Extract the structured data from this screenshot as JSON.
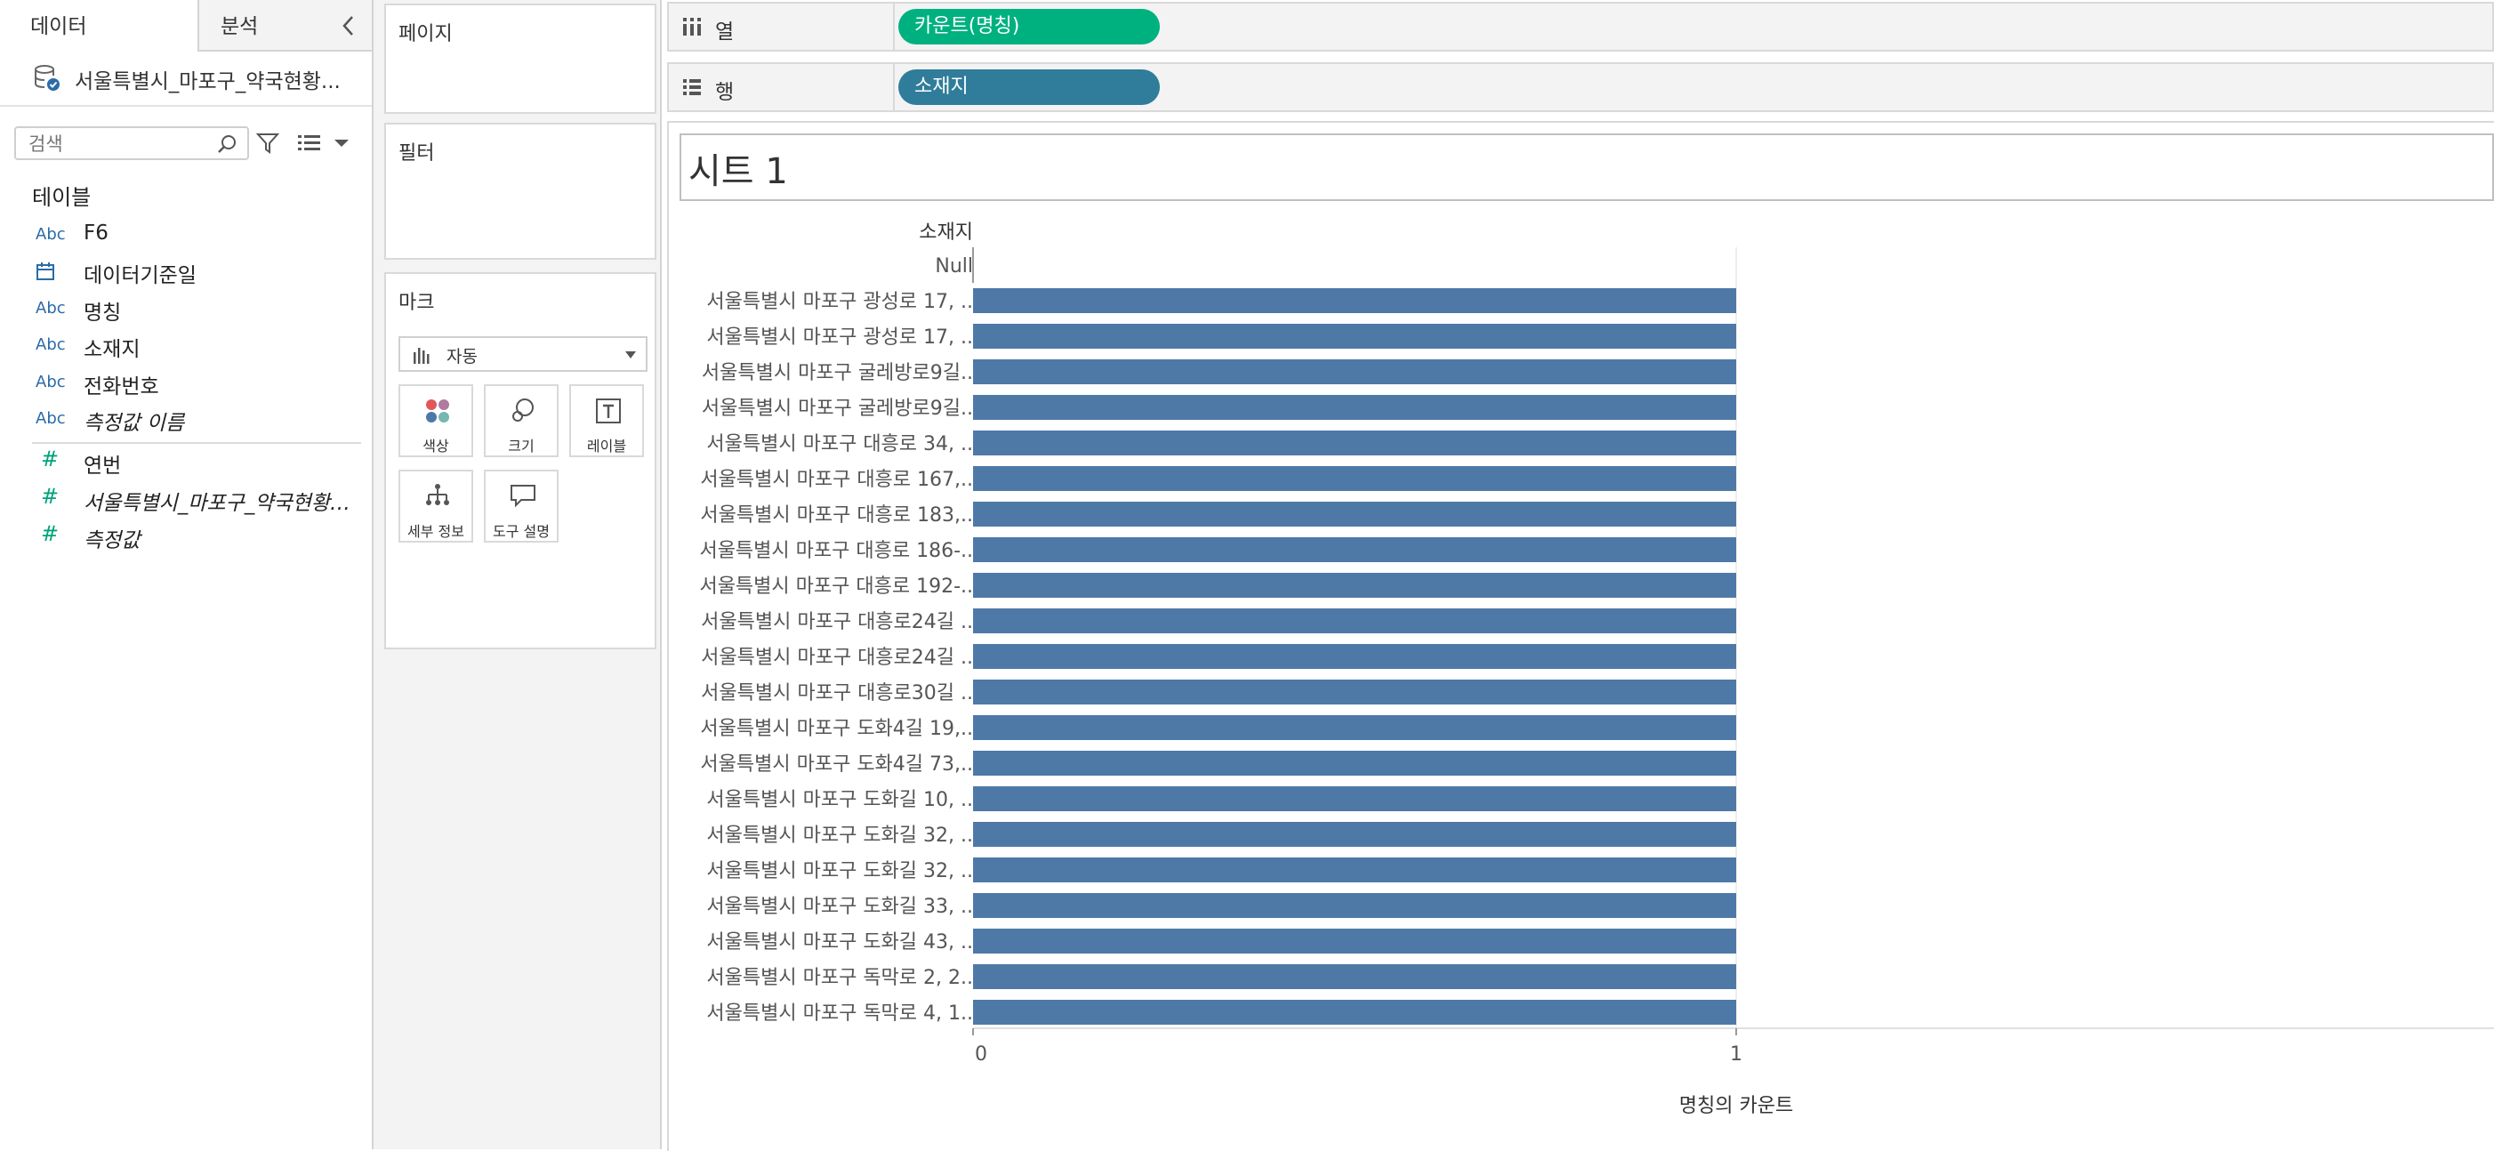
{
  "data_pane": {
    "tab_data": "데이터",
    "tab_analysis": "분석",
    "datasource": "서울특별시_마포구_약국현황...",
    "search_placeholder": "검색",
    "tables_label": "테이블",
    "fields": [
      {
        "type": "Abc",
        "name": "F6",
        "italic": false
      },
      {
        "type": "date",
        "name": "데이터기준일",
        "italic": false
      },
      {
        "type": "Abc",
        "name": "명칭",
        "italic": false
      },
      {
        "type": "Abc",
        "name": "소재지",
        "italic": false
      },
      {
        "type": "Abc",
        "name": "전화번호",
        "italic": false
      },
      {
        "type": "Abc",
        "name": "측정값 이름",
        "italic": true
      },
      {
        "type": "#",
        "name": "연번",
        "italic": false
      },
      {
        "type": "#",
        "name": "서울특별시_마포구_약국현황_...",
        "italic": true
      },
      {
        "type": "#",
        "name": "측정값",
        "italic": true
      }
    ]
  },
  "cards": {
    "pages": "페이지",
    "filters": "필터",
    "marks": "마크",
    "mark_type": "자동",
    "mark_buttons": [
      "색상",
      "크기",
      "레이블",
      "세부 정보",
      "도구 설명"
    ]
  },
  "shelves": {
    "columns_label": "열",
    "columns_pill": "카운트(명칭)",
    "rows_label": "행",
    "rows_pill": "소재지"
  },
  "colors": {
    "columns_pill": "#00b180",
    "rows_pill": "#2f7d9a",
    "bar": "#4e79a7"
  },
  "sheet": {
    "title": "시트 1"
  },
  "chart_data": {
    "type": "bar",
    "orientation": "horizontal",
    "row_header": "소재지",
    "categories": [
      "Null",
      "서울특별시 마포구 광성로 17, ..",
      "서울특별시 마포구 광성로 17, ..",
      "서울특별시 마포구 굴레방로9길..",
      "서울특별시 마포구 굴레방로9길..",
      "서울특별시 마포구 대흥로 34, ..",
      "서울특별시 마포구 대흥로 167,..",
      "서울특별시 마포구 대흥로 183,..",
      "서울특별시 마포구 대흥로 186-..",
      "서울특별시 마포구 대흥로 192-..",
      "서울특별시 마포구 대흥로24길 ..",
      "서울특별시 마포구 대흥로24길 ..",
      "서울특별시 마포구 대흥로30길 ..",
      "서울특별시 마포구 도화4길 19,..",
      "서울특별시 마포구 도화4길 73,..",
      "서울특별시 마포구 도화길 10, ..",
      "서울특별시 마포구 도화길 32, ..",
      "서울특별시 마포구 도화길 32, ..",
      "서울특별시 마포구 도화길 33, ..",
      "서울특별시 마포구 도화길 43, ..",
      "서울특별시 마포구 독막로 2, 2..",
      "서울특별시 마포구 독막로 4, 1.."
    ],
    "values": [
      0,
      1,
      1,
      1,
      1,
      1,
      1,
      1,
      1,
      1,
      1,
      1,
      1,
      1,
      1,
      1,
      1,
      1,
      1,
      1,
      1,
      1
    ],
    "xlabel": "명칭의 카운트",
    "x_ticks": [
      "0",
      "1",
      "2"
    ],
    "xlim": [
      0,
      2
    ]
  }
}
